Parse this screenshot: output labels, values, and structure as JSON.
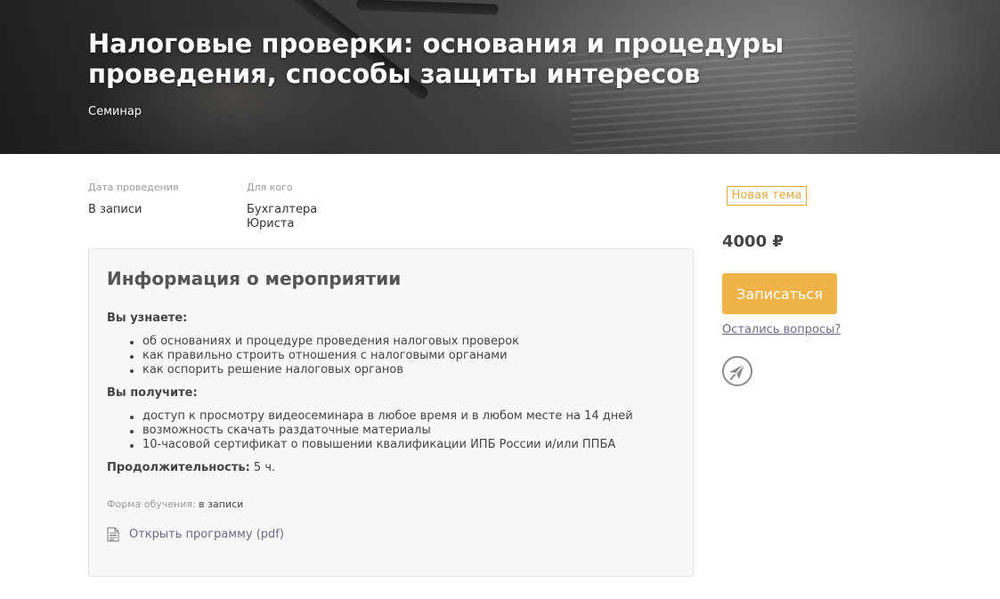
{
  "hero": {
    "title": "Налоговые проверки: основания и процедуры проведения, способы защиты интересов",
    "type": "Семинар"
  },
  "meta": {
    "date": {
      "label": "Дата проведения",
      "value": "В записи"
    },
    "audience": {
      "label": "Для кого",
      "values": [
        "Бухгалтера",
        "Юриста"
      ]
    }
  },
  "info": {
    "title": "Информация о мероприятии",
    "learn": {
      "title": "Вы узнаете:",
      "items": [
        "об основаниях и процедуре проведения налоговых проверок",
        "как правильно строить отношения с налоговыми органами",
        "как оспорить решение налоговых органов"
      ]
    },
    "get": {
      "title": "Вы получите:",
      "items": [
        "доступ к просмотру видеосеминара в любое время и в любом месте на 14 дней",
        "возможность скачать раздаточные материалы",
        "10-часовой сертификат о повышении квалификации ИПБ России и/или ППБА"
      ]
    },
    "duration": {
      "label": "Продолжительность:",
      "value": "5 ч."
    },
    "form": {
      "label": "Форма обучения:",
      "value": "в записи"
    },
    "program_link": "Открыть программу (pdf)",
    "program_icon": "document-icon"
  },
  "sidebar": {
    "badge": "Новая тема",
    "price": "4000 ₽",
    "signup_label": "Записаться",
    "questions_label": "Остались вопросы?",
    "share_icon": "share-icon"
  },
  "colors": {
    "accent": "#f0b34a",
    "badge": "#e3a93c",
    "link": "#6a6a8a",
    "box_bg": "#f8f8f8"
  }
}
